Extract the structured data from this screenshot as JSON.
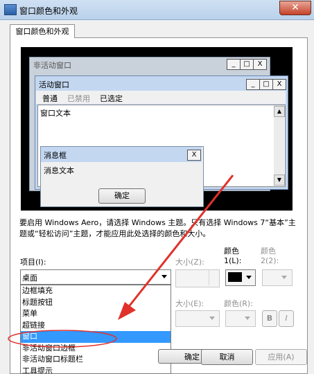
{
  "window": {
    "title": "窗口颜色和外观",
    "close": "✕"
  },
  "tab": {
    "label": "窗口颜色和外观"
  },
  "preview": {
    "inactive_title": "非活动窗口",
    "active_title": "活动窗口",
    "menu": {
      "normal": "普通",
      "disabled": "已禁用",
      "selected": "已选定"
    },
    "window_text": "窗口文本",
    "msgbox_title": "消息框",
    "msgbox_text": "消息文本",
    "ok_button": "确定",
    "cap_min": "_",
    "cap_max": "□",
    "cap_close": "X",
    "scroll_up": "▲",
    "scroll_down": "▼"
  },
  "description": "要启用 Windows Aero，请选择 Windows 主题。只有选择 Windows 7“基本”主题或“轻松访问”主题，才能应用此处选择的颜色和大小。",
  "item": {
    "label": "项目(I):",
    "selected_value": "桌面",
    "options": [
      "边框填充",
      "标题按钮",
      "菜单",
      "超链接",
      "窗口",
      "非活动窗口边框",
      "非活动窗口标题栏",
      "工具提示"
    ],
    "selected_option": "窗口"
  },
  "size1": {
    "label": "大小(Z):"
  },
  "color1": {
    "label_line1": "颜色",
    "label_line2": "1(L):",
    "value": "#000000"
  },
  "color2": {
    "label_line1": "颜色",
    "label_line2": "2(2):"
  },
  "size2": {
    "label": "大小(E):"
  },
  "font_color": {
    "label": "颜色(R):"
  },
  "bold_button": "B",
  "italic_button": "I",
  "buttons": {
    "ok": "确定",
    "cancel": "取消",
    "apply": "应用(A)"
  },
  "annotation_colors": {
    "arrow": "#e0322b",
    "ellipse": "#e0322b"
  }
}
